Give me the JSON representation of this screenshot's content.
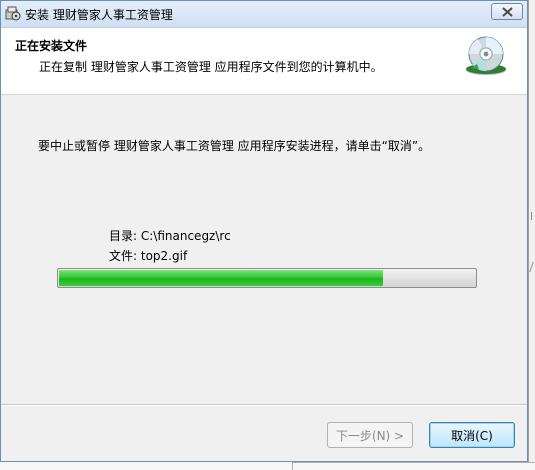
{
  "window": {
    "title": "安装 理财管家人事工资管理",
    "close_label": "close"
  },
  "header": {
    "title": "正在安装文件",
    "subtitle": "正在复制 理财管家人事工资管理 应用程序文件到您的计算机中。",
    "icon": "cd-disc-icon"
  },
  "body": {
    "instruction": "要中止或暂停 理财管家人事工资管理 应用程序安装进程，请单击“取消”。",
    "directory_label": "目录:",
    "directory_value": "C:\\financegz\\rc",
    "file_label": "文件:",
    "file_value": "top2.gif",
    "progress": 0.78
  },
  "buttons": {
    "next_label": "下一步(N) >",
    "cancel_label": "取消(C)"
  },
  "colors": {
    "progress_fill": "#22b822",
    "titlebar": "#cfe0f3"
  }
}
